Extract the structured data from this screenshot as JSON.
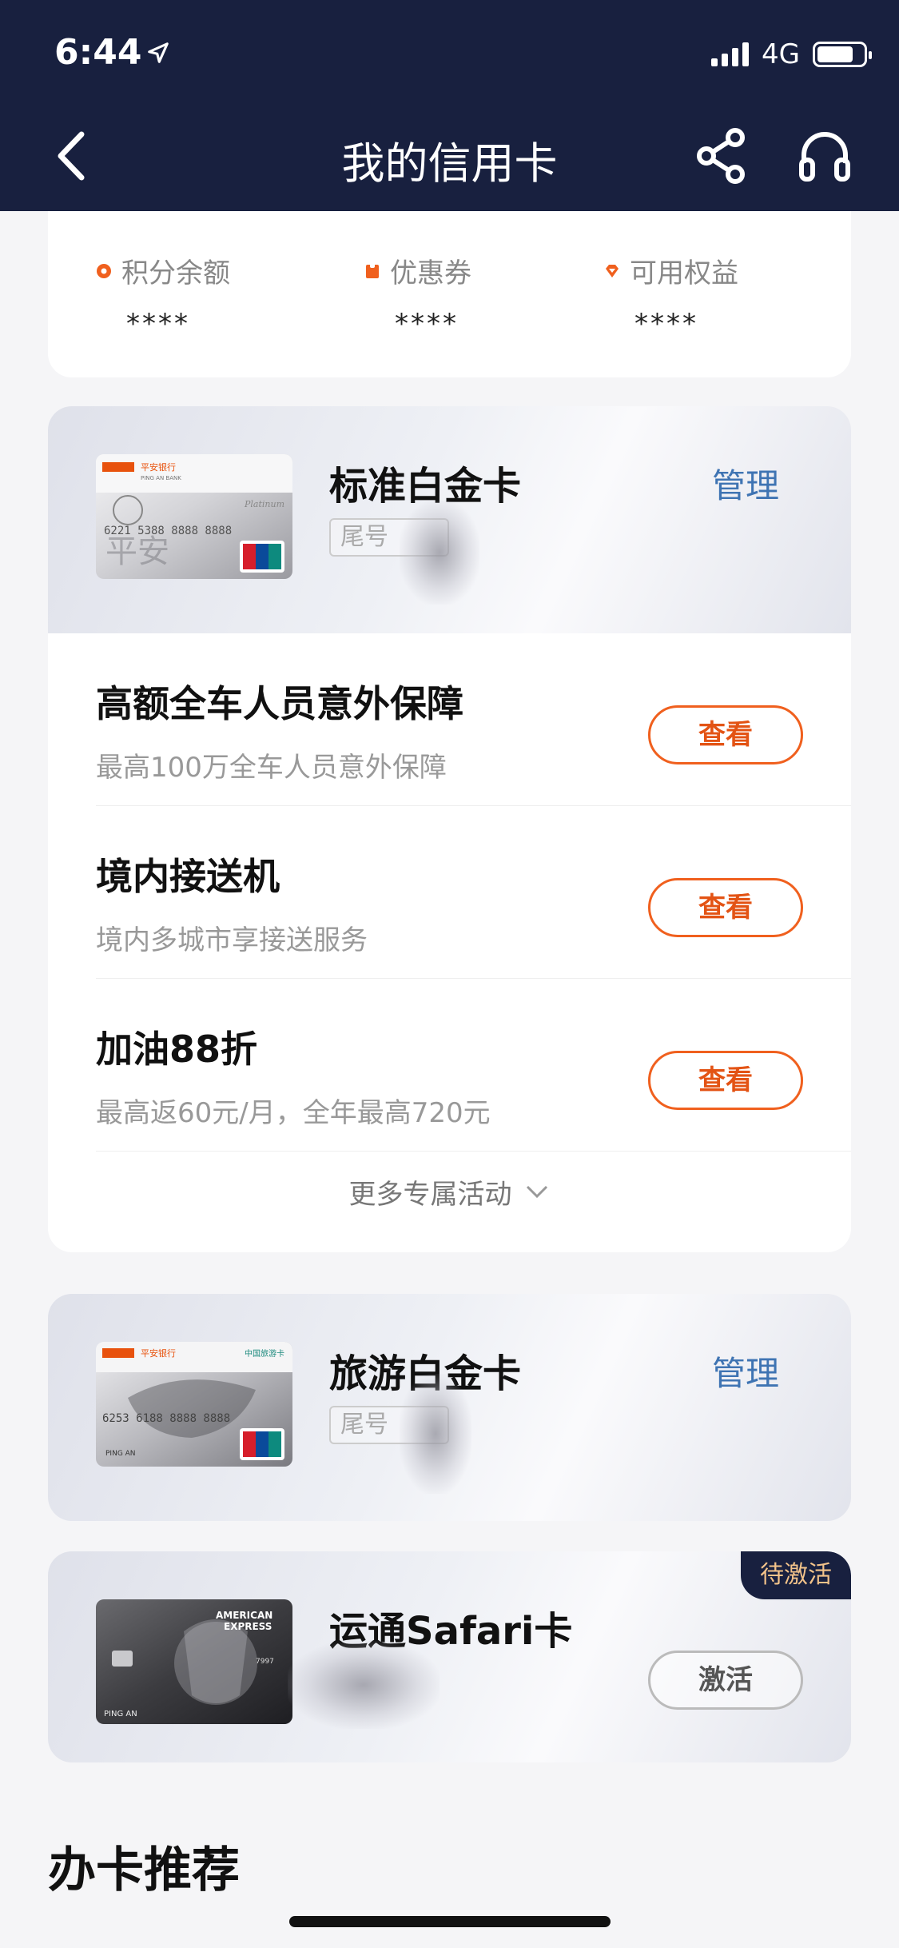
{
  "status_bar": {
    "time": "6:44",
    "network": "4G"
  },
  "nav": {
    "title": "我的信用卡"
  },
  "points": [
    {
      "label": "积分余额",
      "value": "****",
      "icon": "points-dot-icon"
    },
    {
      "label": "优惠券",
      "value": "****",
      "icon": "coupon-icon"
    },
    {
      "label": "可用权益",
      "value": "****",
      "icon": "gem-icon"
    }
  ],
  "cards": [
    {
      "name": "标准白金卡",
      "tail_label": "尾号",
      "manage_label": "管理",
      "card_bank": "平安银行",
      "card_number": "6221 5388 8888 8888",
      "benefits": [
        {
          "title": "高额全车人员意外保障",
          "subtitle": "最高100万全车人员意外保障",
          "button": "查看"
        },
        {
          "title": "境内接送机",
          "subtitle": "境内多城市享接送服务",
          "button": "查看"
        },
        {
          "title": "加油88折",
          "subtitle": "最高返60元/月，全年最高720元",
          "button": "查看"
        }
      ],
      "more_label": "更多专属活动"
    },
    {
      "name": "旅游白金卡",
      "tail_label": "尾号",
      "manage_label": "管理",
      "card_bank": "平安银行",
      "card_number": "6253 6188 8888 8888"
    },
    {
      "name": "运通Safari卡",
      "badge": "待激活",
      "activate_label": "激活",
      "card_brand": "AMERICAN EXPRESS",
      "card_holder": "PING AN"
    }
  ],
  "section": {
    "title": "办卡推荐"
  },
  "colors": {
    "header_bg": "#18203f",
    "accent_orange": "#f0601e",
    "link_blue": "#3f74b3",
    "badge_text": "#f3c38a"
  }
}
